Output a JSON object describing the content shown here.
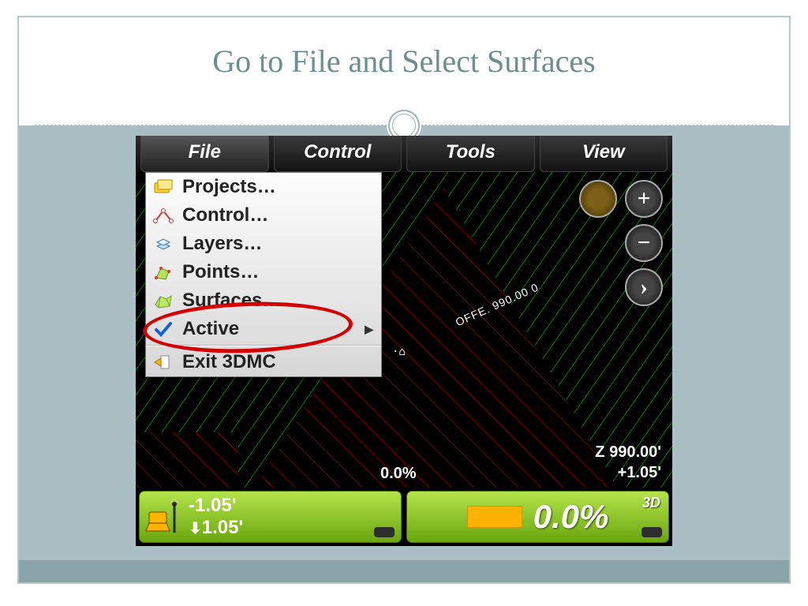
{
  "title": "Go to File and Select Surfaces",
  "menubar": {
    "file": "File",
    "control": "Control",
    "tools": "Tools",
    "view": "View"
  },
  "dropdown": {
    "projects": "Projects…",
    "control": "Control…",
    "layers": "Layers…",
    "points": "Points…",
    "surfaces": "Surfaces…",
    "active": "Active",
    "exit": "Exit 3DMC"
  },
  "canvas": {
    "rot_label": "OFFE. 990.00 0",
    "marker": "·⌂"
  },
  "info": {
    "center_pct": "0.0%",
    "z": "Z 990.00'",
    "delta": "+1.05'"
  },
  "statusLeft": {
    "top": "-1.05'",
    "bottom": "1.05'"
  },
  "statusRight": {
    "value": "0.0%",
    "mode": "3D"
  },
  "icons": {
    "plus": "+",
    "minus": "−",
    "chevron": "›"
  }
}
